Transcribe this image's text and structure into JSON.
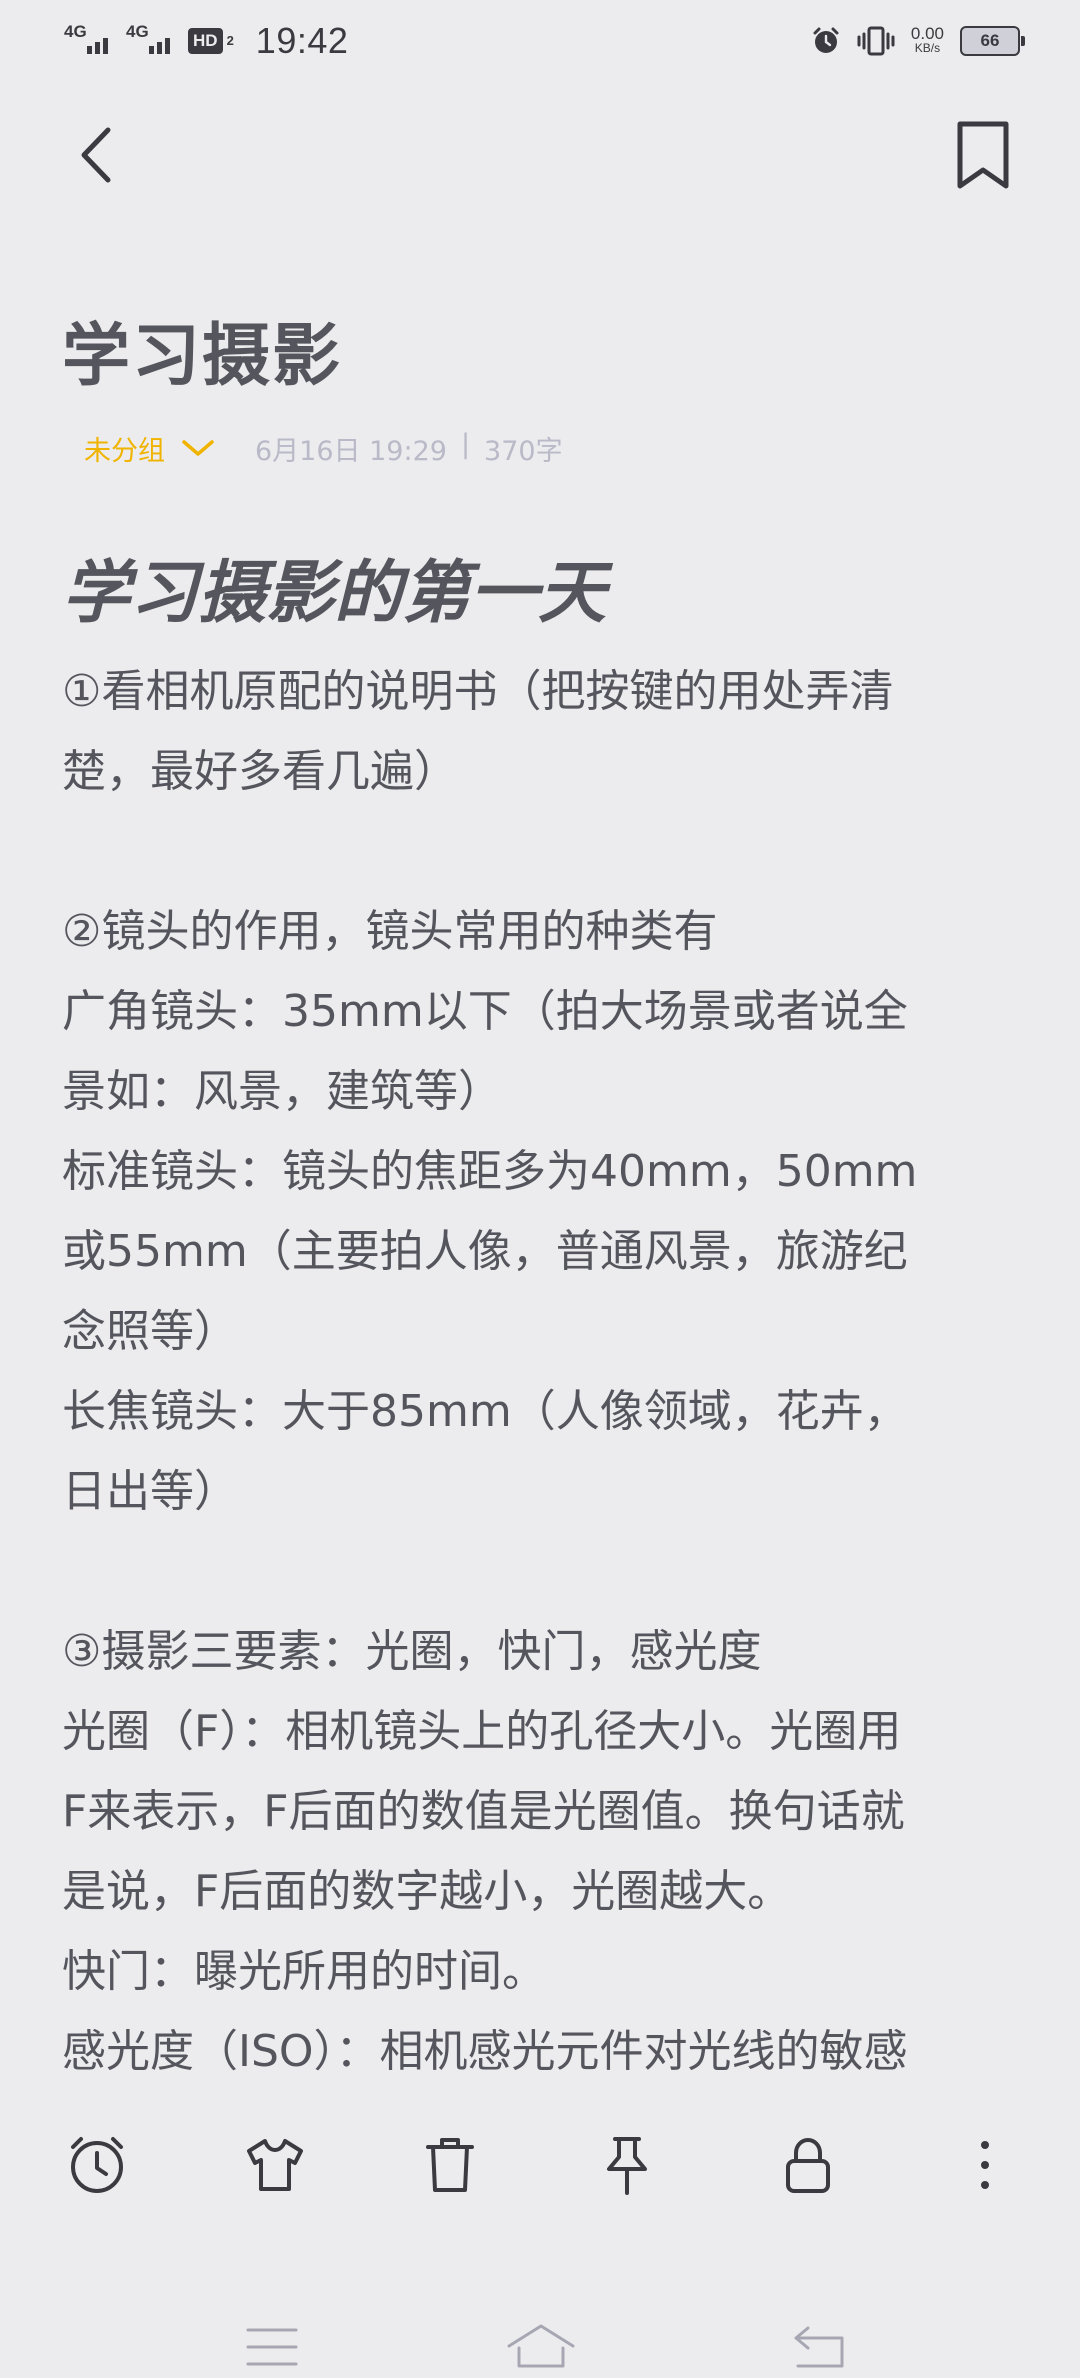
{
  "status_bar": {
    "sim1": "4G",
    "sim2": "4G",
    "hd": "HD",
    "hd_sub": "2",
    "time": "19:42",
    "net_speed_value": "0.00",
    "net_speed_unit": "KB/s",
    "battery": "66"
  },
  "note": {
    "title": "学习摄影",
    "group": "未分组",
    "date": "6月16日 19:29",
    "separator": "|",
    "word_count": "370字",
    "heading": "学习摄影的第一天",
    "lines": [
      "①看相机原配的说明书（把按键的用处弄清",
      "楚，最好多看几遍）",
      "",
      "②镜头的作用，镜头常用的种类有",
      "广角镜头：35mm以下（拍大场景或者说全",
      "景如：风景，建筑等）",
      "标准镜头：镜头的焦距多为40mm，50mm",
      "或55mm（主要拍人像，普通风景，旅游纪",
      "念照等）",
      "长焦镜头：大于85mm（人像领域，花卉，",
      "日出等）",
      "",
      "③摄影三要素：光圈，快门，感光度",
      "光圈（F）：相机镜头上的孔径大小。光圈用",
      "F来表示，F后面的数值是光圈值。换句话就",
      "是说，F后面的数字越小，光圈越大。",
      "快门：曝光所用的时间。",
      "感光度（ISO）：相机感光元件对光线的敏感"
    ]
  },
  "colors": {
    "background": "#ececee",
    "text": "#55555d",
    "group_accent": "#f0b400",
    "meta_text": "#b9b9c8"
  },
  "icons": {
    "back": "chevron-left-icon",
    "bookmark": "bookmark-icon",
    "toolbar": [
      "alarm-icon",
      "tshirt-icon",
      "trash-icon",
      "pin-icon",
      "lock-icon",
      "more-vertical-icon"
    ],
    "nav": [
      "menu-icon",
      "home-icon",
      "back-arrow-icon"
    ]
  }
}
